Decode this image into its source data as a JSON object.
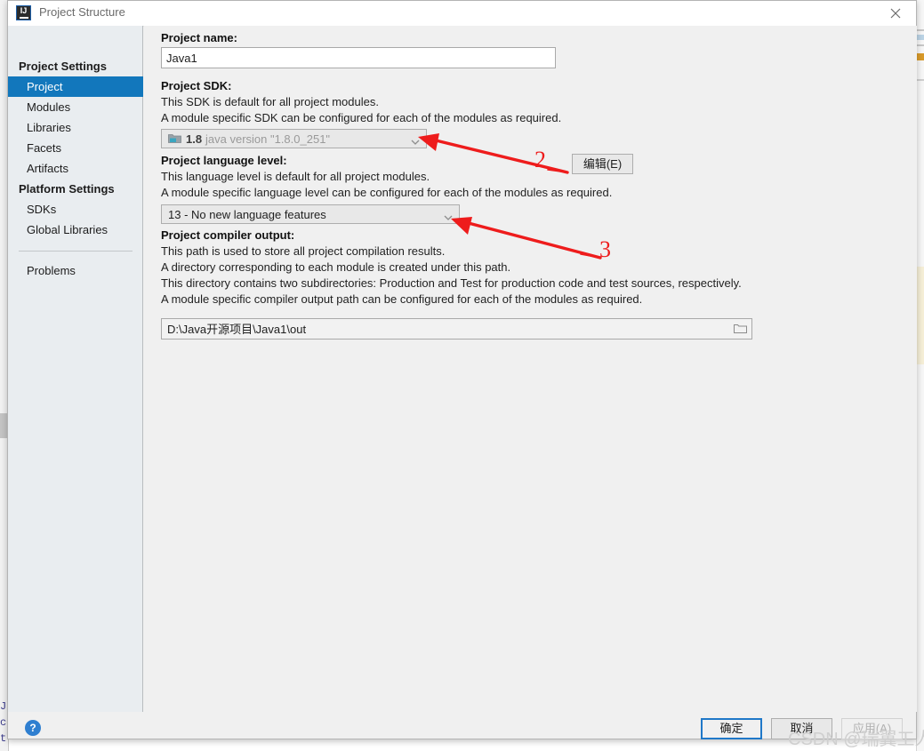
{
  "window": {
    "title": "Project Structure",
    "app_icon": "intellij-idea-icon",
    "close_icon": "close-icon",
    "back_icon": "arrow-left-icon",
    "forward_icon": "arrow-right-icon"
  },
  "sidebar": {
    "groups": [
      {
        "header": "Project Settings",
        "items": [
          {
            "label": "Project",
            "selected": true
          },
          {
            "label": "Modules",
            "selected": false
          },
          {
            "label": "Libraries",
            "selected": false
          },
          {
            "label": "Facets",
            "selected": false
          },
          {
            "label": "Artifacts",
            "selected": false
          }
        ]
      },
      {
        "header": "Platform Settings",
        "items": [
          {
            "label": "SDKs",
            "selected": false
          },
          {
            "label": "Global Libraries",
            "selected": false
          }
        ]
      }
    ],
    "extra_item": "Problems"
  },
  "main": {
    "project_name": {
      "label": "Project name:",
      "value": "Java1"
    },
    "project_sdk": {
      "label": "Project SDK:",
      "desc_line1": "This SDK is default for all project modules.",
      "desc_line2": "A module specific SDK can be configured for each of the modules as required.",
      "sdk_icon": "java-sdk-folder-icon",
      "sdk_name": "1.8",
      "sdk_version": "java version \"1.8.0_251\"",
      "chevron_icon": "chevron-down-icon",
      "edit_button": "编辑(E)"
    },
    "language_level": {
      "label": "Project language level:",
      "desc_line1": "This language level is default for all project modules.",
      "desc_line2": "A module specific language level can be configured for each of the modules as required.",
      "value": "13 - No new language features",
      "chevron_icon": "chevron-down-icon"
    },
    "compiler_output": {
      "label": "Project compiler output:",
      "desc_line1": "This path is used to store all project compilation results.",
      "desc_line2": "A directory corresponding to each module is created under this path.",
      "desc_line3": "This directory contains two subdirectories: Production and Test for production code and test sources, respectively.",
      "desc_line4": "A module specific compiler output path can be configured for each of the modules as required.",
      "value": "D:\\Java开源项目\\Java1\\out",
      "browse_icon": "folder-browse-icon"
    }
  },
  "annotations": {
    "arrow_color": "#ee1c1c",
    "markers": [
      {
        "number": "2",
        "target": "project-sdk-combo"
      },
      {
        "number": "3",
        "target": "language-level-combo"
      }
    ]
  },
  "footer": {
    "help_icon": "help-question-icon",
    "help_label": "?",
    "ok_button": "确定",
    "cancel_button": "取消",
    "apply_button": "应用(A)"
  },
  "watermark": {
    "text": "CSDN @瑞翼工人"
  },
  "background": {
    "fragments": [
      "J.",
      "ce",
      "t"
    ]
  },
  "colors": {
    "accent": "#1277bc",
    "annotation_red": "#ee1c1c",
    "sidebar_bg": "#e9edf0",
    "dialog_bg": "#f0f0f0",
    "focus_border": "#1f78c8"
  }
}
